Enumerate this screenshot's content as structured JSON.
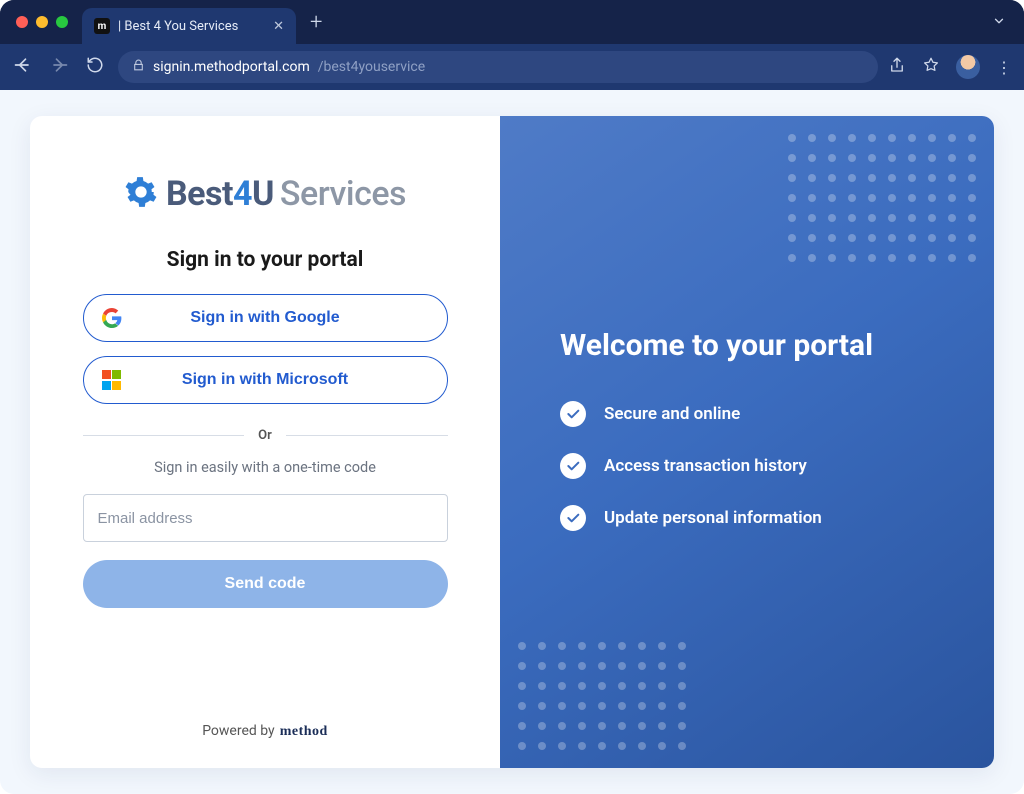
{
  "browser": {
    "tab_title": "| Best 4 You Services",
    "favicon_letter": "m",
    "url_host": "signin.methodportal.com",
    "url_path": "/best4youservice"
  },
  "logo": {
    "part_best": "Best",
    "part_four": "4",
    "part_u": "U",
    "part_services": "Services"
  },
  "signin": {
    "heading": "Sign in to your portal",
    "google_label": "Sign in with Google",
    "microsoft_label": "Sign in with Microsoft",
    "or_label": "Or",
    "easy_label": "Sign in easily with a one-time code",
    "email_placeholder": "Email address",
    "send_label": "Send code"
  },
  "powered": {
    "prefix": "Powered by",
    "brand": "method"
  },
  "panel": {
    "heading": "Welcome to your portal",
    "features": [
      "Secure and online",
      "Access transaction history",
      "Update personal information"
    ]
  }
}
